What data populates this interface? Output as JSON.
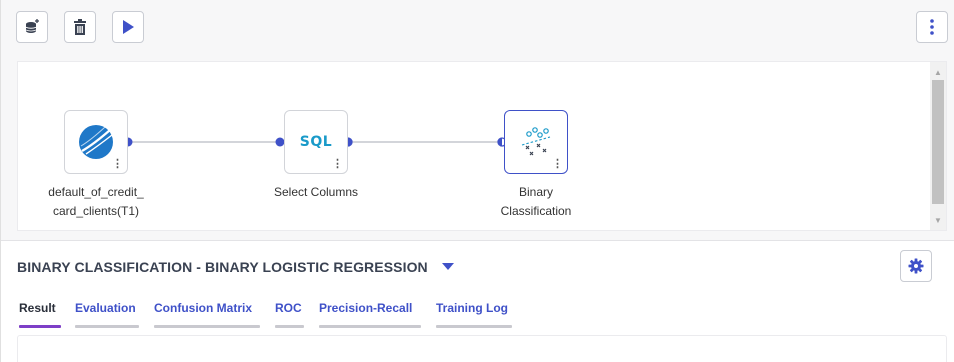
{
  "toolbar": {
    "buttons": [
      {
        "icon": "add-database-icon"
      },
      {
        "icon": "trash-icon"
      },
      {
        "icon": "play-icon"
      }
    ],
    "more_icon": "vertical-ellipsis-icon"
  },
  "flow": {
    "nodes": [
      {
        "label": "default_of_credit_card_clients(T1)",
        "label_lines": [
          "default_of_credit_",
          "card_clients(T1)"
        ],
        "icon": "dataset-logo-icon"
      },
      {
        "label": "Select Columns",
        "label_lines": [
          "Select Columns"
        ],
        "icon_text": "SQL"
      },
      {
        "label": "Binary Classification",
        "label_lines": [
          "Binary",
          "Classification"
        ],
        "icon": "scatter-classification-icon",
        "selected": true
      }
    ]
  },
  "panel": {
    "title": "BINARY CLASSIFICATION - BINARY LOGISTIC REGRESSION",
    "tabs": [
      "Result",
      "Evaluation",
      "Confusion Matrix",
      "ROC",
      "Precision-Recall",
      "Training Log"
    ],
    "active_tab": "Result"
  },
  "colors": {
    "accent": "#3f51c8",
    "active_tab_underline": "#7e3fc7",
    "sql_text": "#1a9ac9"
  }
}
